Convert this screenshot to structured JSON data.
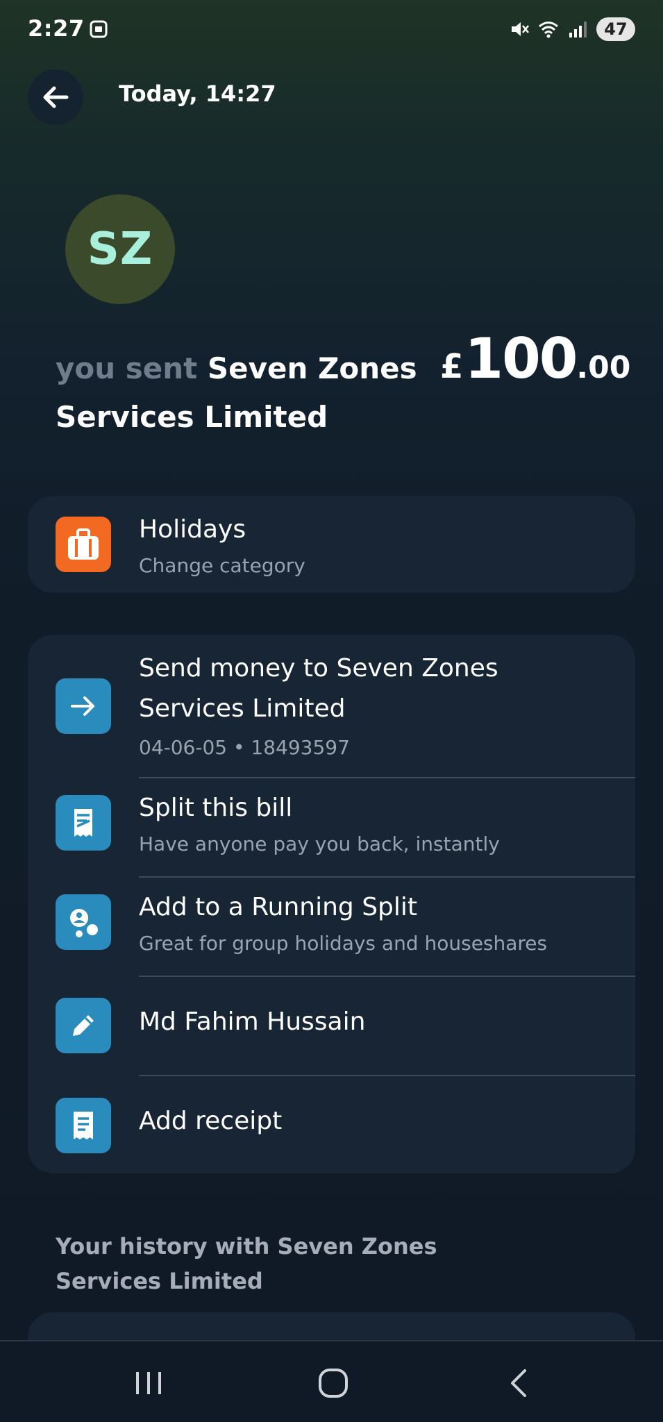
{
  "status_bar": {
    "time": "2:27",
    "battery": "47",
    "icons": [
      "screenshot-icon",
      "mute-icon",
      "wifi-icon",
      "signal-icon",
      "battery-icon"
    ]
  },
  "header": {
    "title": "Today, 14:27",
    "back_icon": "arrow-left-icon"
  },
  "avatar": {
    "initials": "SZ"
  },
  "summary": {
    "prefix": "you sent",
    "recipient": "Seven Zones Services Limited",
    "amount_currency": "£",
    "amount_integer": "100",
    "amount_decimal": ".00"
  },
  "category": {
    "title": "Holidays",
    "subtitle": "Change category",
    "icon": "suitcase-icon",
    "color": "#f26a21"
  },
  "actions": [
    {
      "title_line1": "Send money to Seven Zones",
      "title_line2": "Services Limited",
      "subtitle": "04-06-05 • 18493597",
      "icon": "arrow-right-icon"
    },
    {
      "title": "Split this bill",
      "subtitle": "Have anyone pay you back, instantly",
      "icon": "split-bill-icon"
    },
    {
      "title": "Add to a Running Split",
      "subtitle": "Great for group holidays and houseshares",
      "icon": "running-split-icon"
    },
    {
      "title": "Md Fahim Hussain",
      "icon": "pencil-icon"
    },
    {
      "title": "Add receipt",
      "icon": "receipt-icon"
    }
  ],
  "history": {
    "title": "Your history with Seven Zones Services Limited"
  },
  "nav": {
    "icons": [
      "recent-apps-icon",
      "home-icon",
      "back-icon"
    ]
  },
  "colors": {
    "accent_blue": "#2a8bbd",
    "accent_orange": "#f26a21",
    "card_bg": "#172534",
    "avatar_bg": "#3a4a2a",
    "avatar_text": "#a8f0dc"
  }
}
